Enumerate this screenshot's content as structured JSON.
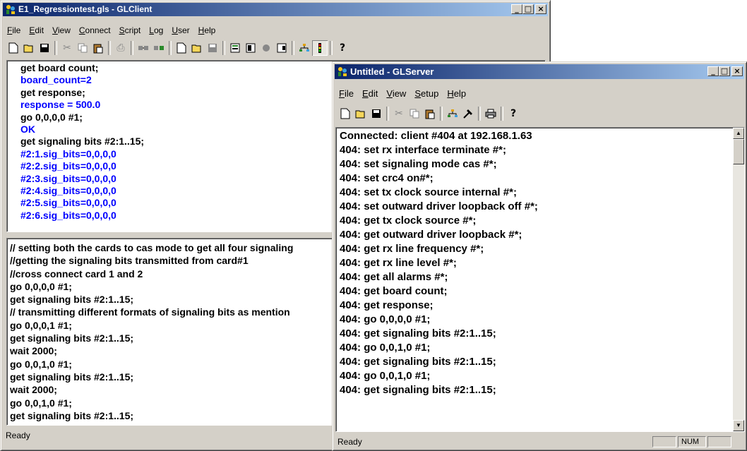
{
  "client": {
    "title": "E1_Regressiontest.gls - GLClient",
    "caption_buttons": {
      "minimize": "_",
      "maximize": "□",
      "close": "×"
    },
    "menu": [
      "File",
      "Edit",
      "View",
      "Connect",
      "Script",
      "Log",
      "User",
      "Help"
    ],
    "toolbar_icons": [
      "new-icon",
      "open-icon",
      "save-icon",
      "cut-icon",
      "copy-icon",
      "paste-icon",
      "print-icon",
      "connect-icon",
      "disconnect-icon",
      "new-script-icon",
      "open-script-icon",
      "save-script-icon",
      "run-icon",
      "step-icon",
      "record-icon",
      "stop-icon",
      "network-icon",
      "signal-icon",
      "help-icon"
    ],
    "output_lines": [
      {
        "text": "get board count;",
        "color": "#000000"
      },
      {
        "text": "board_count=2",
        "color": "#0000ff"
      },
      {
        "text": "get response;",
        "color": "#000000"
      },
      {
        "text": "response = 500.0",
        "color": "#0000ff"
      },
      {
        "text": "go 0,0,0,0 #1;",
        "color": "#000000"
      },
      {
        "text": "OK",
        "color": "#0000ff"
      },
      {
        "text": "get signaling bits #2:1..15;",
        "color": "#000000"
      },
      {
        "text": "#2:1.sig_bits=0,0,0,0",
        "color": "#0000ff"
      },
      {
        "text": "#2:2.sig_bits=0,0,0,0",
        "color": "#0000ff"
      },
      {
        "text": "#2:3.sig_bits=0,0,0,0",
        "color": "#0000ff"
      },
      {
        "text": "#2:4.sig_bits=0,0,0,0",
        "color": "#0000ff"
      },
      {
        "text": "#2:5.sig_bits=0,0,0,0",
        "color": "#0000ff"
      },
      {
        "text": "#2:6.sig_bits=0,0,0,0",
        "color": "#0000ff"
      }
    ],
    "script_lines": [
      "// setting both the cards to cas mode to get all four signaling",
      "//getting the signaling bits transmitted from card#1",
      "//cross connect card 1 and 2",
      "go 0,0,0,0 #1;",
      "get signaling bits #2:1..15;",
      "// transmitting  different formats of signaling bits as mention",
      "go 0,0,0,1 #1;",
      "get signaling bits #2:1..15;",
      "wait 2000;",
      "go 0,0,1,0 #1;",
      "get signaling bits #2:1..15;",
      "wait 2000;",
      "go 0,0,1,0 #1;",
      "get signaling bits #2:1..15;"
    ],
    "status": "Ready"
  },
  "server": {
    "title": "Untitled - GLServer",
    "caption_buttons": {
      "minimize": "_",
      "maximize": "□",
      "close": "×"
    },
    "menu": [
      "File",
      "Edit",
      "View",
      "Setup",
      "Help"
    ],
    "toolbar_icons": [
      "new-icon",
      "open-icon",
      "save-icon",
      "cut-icon",
      "copy-icon",
      "paste-icon",
      "network-icon",
      "tools-icon",
      "print-icon",
      "help-icon"
    ],
    "log_lines": [
      "Connected: client #404 at 192.168.1.63",
      "404: set rx interface terminate #*;",
      "404: set signaling mode cas #*;",
      "404: set crc4 on#*;",
      "404: set tx clock source internal #*;",
      "404: set outward driver loopback off #*;",
      "404: get tx clock source #*;",
      "404: get outward driver loopback #*;",
      "404: get rx line frequency #*;",
      "404: get rx line level #*;",
      "404: get all alarms #*;",
      "404: get board count;",
      "404: get response;",
      "404: go 0,0,0,0 #1;",
      "404: get signaling bits #2:1..15;",
      "404: go 0,0,1,0 #1;",
      "404: get signaling bits #2:1..15;",
      "404: go 0,0,1,0 #1;",
      "404: get signaling bits #2:1..15;"
    ],
    "status": "Ready",
    "status_num": "NUM"
  }
}
